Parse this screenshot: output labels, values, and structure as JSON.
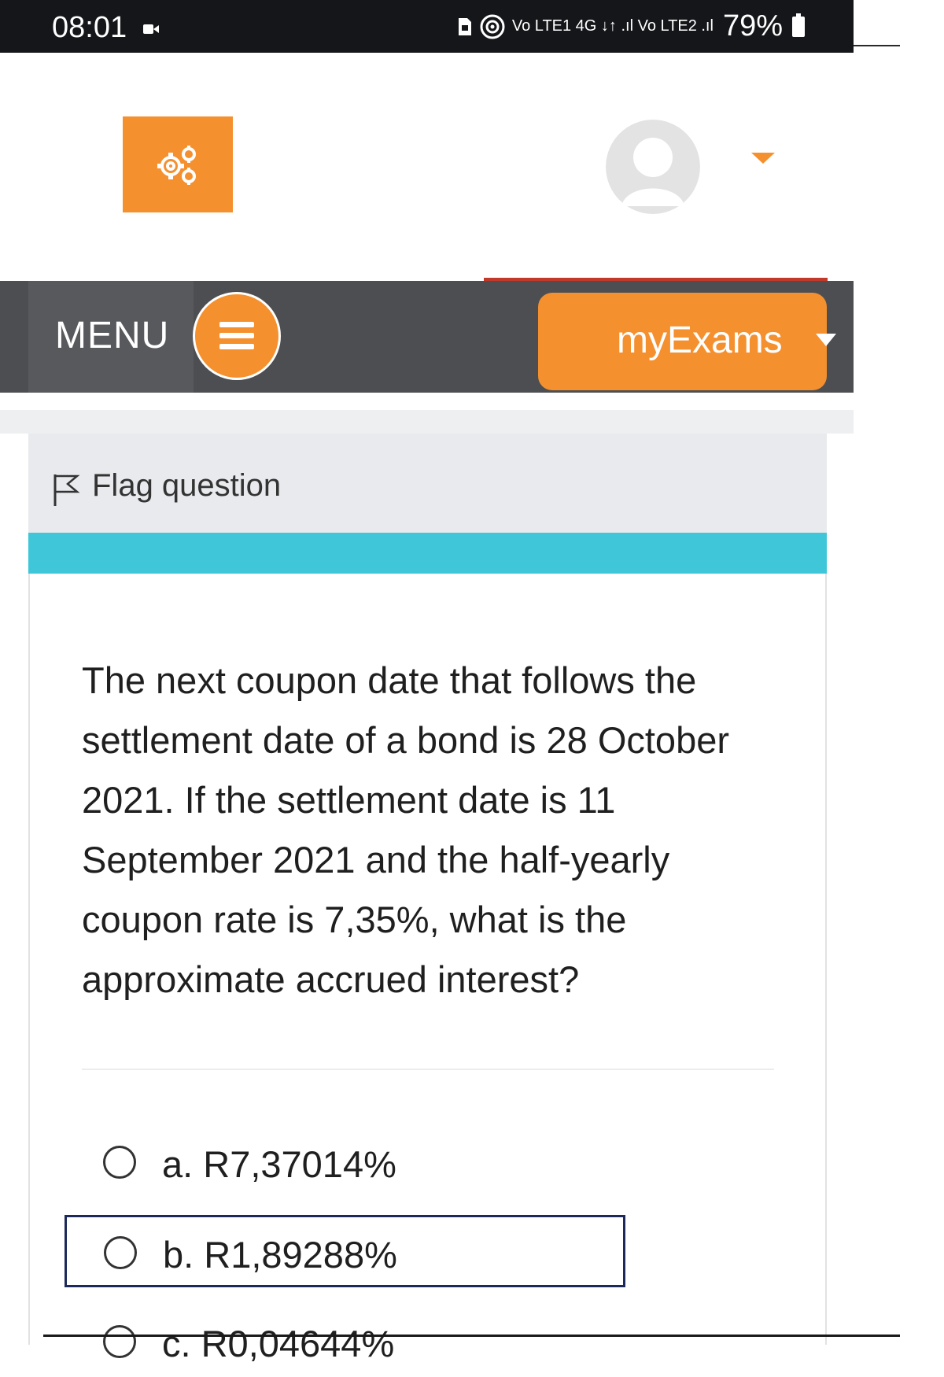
{
  "status_bar": {
    "time": "08:01",
    "network_glyphs": "Vo LTE1 4G ↓↑ .ıl Vo LTE2 .ıl",
    "battery": "79%"
  },
  "header": {
    "settings_icon": "gears-icon",
    "avatar_icon": "user-avatar-icon",
    "dropdown_icon": "caret-down-icon"
  },
  "nav": {
    "menu_label": "MENU",
    "menu_icon": "hamburger-icon",
    "exams_label": "myExams"
  },
  "question_info": {
    "flag_label": "Flag question"
  },
  "question": {
    "text": "The next coupon date that follows the settlement date of a bond is 28 October 2021. If the settlement date is 11 September 2021 and the half-yearly coupon rate is 7,35%, what is the approximate accrued interest?"
  },
  "options": [
    {
      "label": "a. R7,37014%"
    },
    {
      "label": "b. R1,89288%"
    },
    {
      "label": "c. R0,04644%"
    }
  ],
  "colors": {
    "accent_orange": "#f5902e",
    "nav_dark": "#4d4e52",
    "info_bar": "#3fc7d9",
    "focus_border": "#1b2a5a"
  }
}
